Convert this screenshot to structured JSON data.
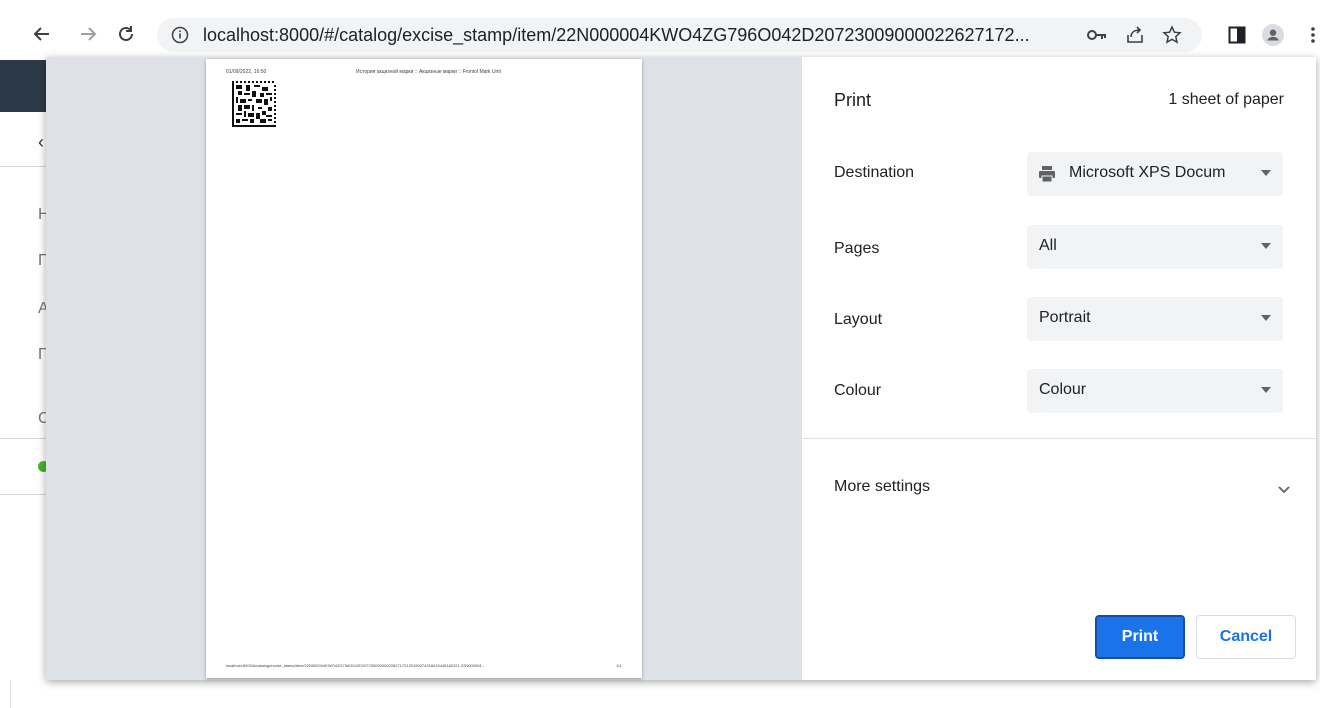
{
  "browser": {
    "url": "localhost:8000/#/catalog/excise_stamp/item/22N000004KWO4ZG796O042D20723009000022627172..."
  },
  "background_page": {
    "letters": [
      "Н",
      "П",
      "А",
      "П",
      "С"
    ]
  },
  "preview": {
    "header_left": "01/09/2022, 16:50",
    "header_center": "История акцизной марки :: Акцизные марки :: Frontol Mark Unit",
    "footer_left": "localhost:8000/#/catalog/excise_stamp/item/22N000004KWO4ZG796O042D20723009000022627172120190074318415446182221 22N000004...",
    "footer_right": "1/1"
  },
  "print_panel": {
    "title": "Print",
    "sheet_count": "1 sheet of paper",
    "rows": [
      {
        "label": "Destination",
        "value": "Microsoft XPS Docum"
      },
      {
        "label": "Pages",
        "value": "All"
      },
      {
        "label": "Layout",
        "value": "Portrait"
      },
      {
        "label": "Colour",
        "value": "Colour"
      }
    ],
    "more_settings": "More settings",
    "print_button": "Print",
    "cancel_button": "Cancel"
  }
}
